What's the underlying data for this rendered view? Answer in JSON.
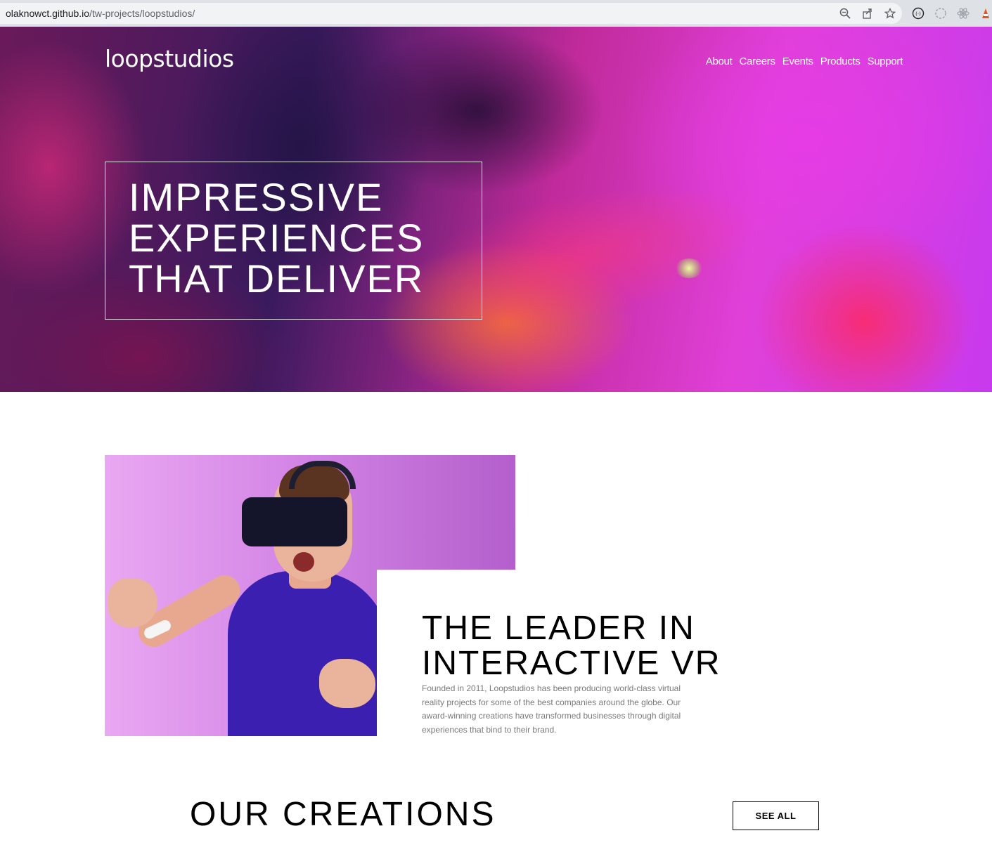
{
  "browser": {
    "url_host": "olaknowct.github.io",
    "url_path": "/tw-projects/loopstudios/",
    "icons": [
      "zoom-icon",
      "share-icon",
      "bookmark-star-icon",
      "extension-icon",
      "extension-icon",
      "extension-icon",
      "extension-icon"
    ]
  },
  "header": {
    "logo": "loopstudios",
    "nav": [
      "About",
      "Careers",
      "Events",
      "Products",
      "Support"
    ]
  },
  "hero": {
    "title_lines": [
      "IMPRESSIVE",
      "EXPERIENCES",
      "THAT DELIVER"
    ]
  },
  "about": {
    "title_lines": [
      "THE LEADER IN",
      "INTERACTIVE VR"
    ],
    "text": "Founded in 2011, Loopstudios has been producing world-class virtual reality projects for some of the best companies around the globe. Our award-winning creations have transformed businesses through digital experiences that bind to their brand."
  },
  "creations": {
    "title": "OUR CREATIONS",
    "button": "SEE ALL"
  },
  "colors": {
    "hero_accent": "#e040d8",
    "text_dark": "#000000",
    "text_muted": "#7a7a7a"
  }
}
